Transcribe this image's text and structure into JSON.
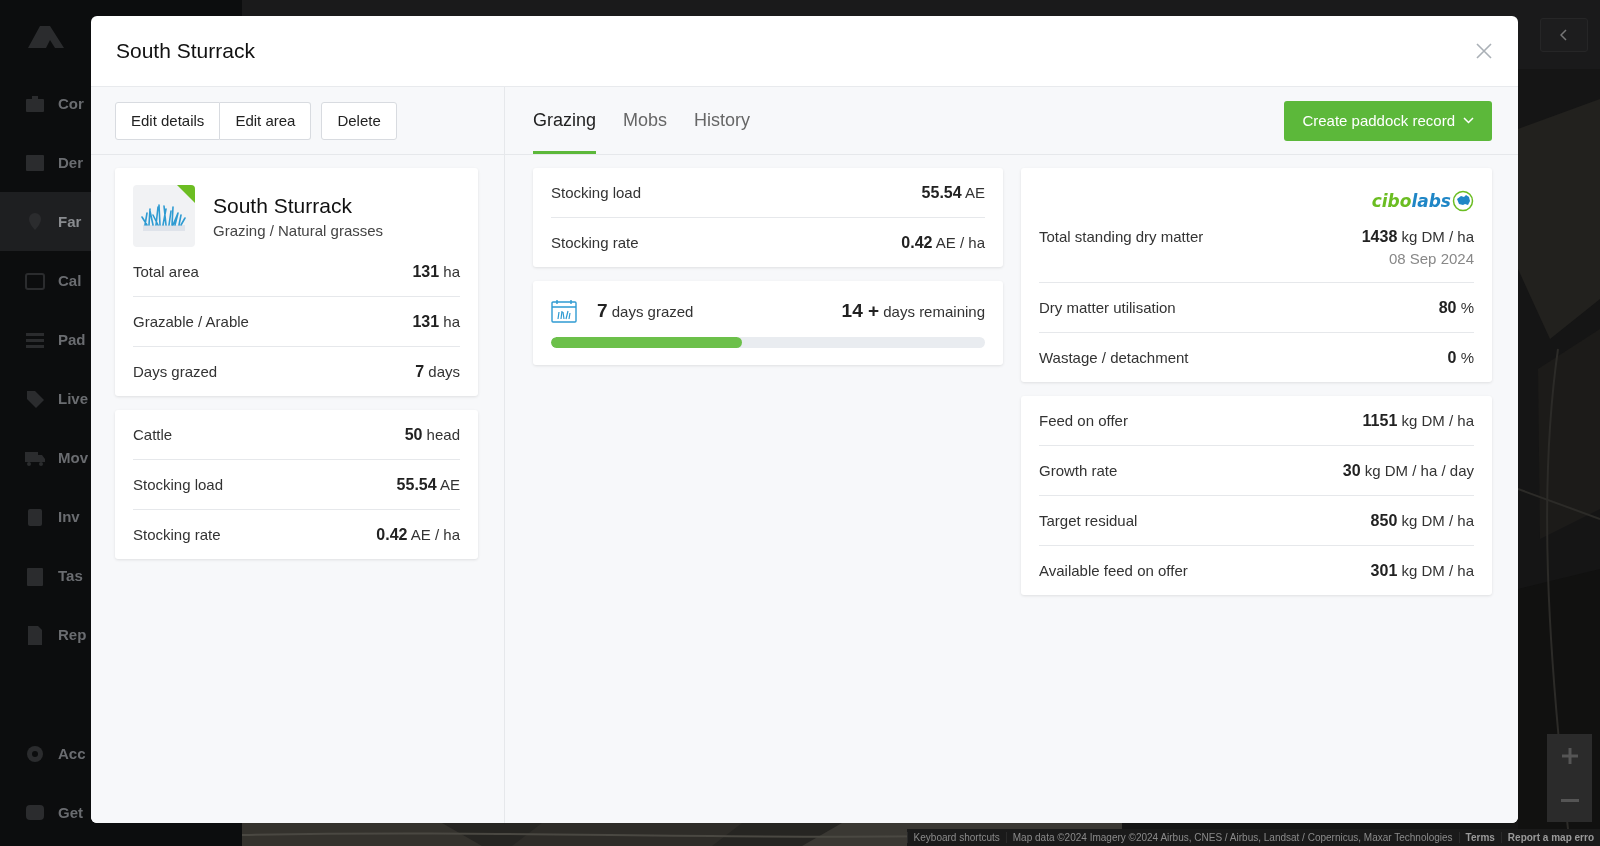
{
  "sidebar": {
    "items": [
      {
        "label": "Cor",
        "selected": false
      },
      {
        "label": "Der",
        "selected": false
      },
      {
        "label": "Far",
        "selected": true
      },
      {
        "label": "Cal",
        "selected": false
      },
      {
        "label": "Pad",
        "selected": false
      },
      {
        "label": "Live",
        "selected": false
      },
      {
        "label": "Mov",
        "selected": false
      },
      {
        "label": "Inv",
        "selected": false
      },
      {
        "label": "Tas",
        "selected": false
      },
      {
        "label": "Rep",
        "selected": false
      }
    ],
    "bottom_items": [
      {
        "label": "Acc",
        "selected": false
      },
      {
        "label": "Get",
        "selected": false
      }
    ]
  },
  "map": {
    "attribution": [
      "Keyboard shortcuts",
      "Map data ©2024 Imagery ©2024 Airbus, CNES / Airbus, Landsat / Copernicus, Maxar Technologies",
      "Terms",
      "Report a map erro"
    ]
  },
  "modal": {
    "title": "South Sturrack",
    "actions": [
      "Edit details",
      "Edit area",
      "Delete"
    ],
    "paddock": {
      "name": "South Sturrack",
      "subtitle": "Grazing / Natural grasses"
    },
    "summary": [
      {
        "label": "Total area",
        "value": "131",
        "unit": "ha"
      },
      {
        "label": "Grazable / Arable",
        "value": "131",
        "unit": "ha"
      },
      {
        "label": "Days grazed",
        "value": "7",
        "unit": "days"
      }
    ],
    "livestock": [
      {
        "label": "Cattle",
        "value": "50",
        "unit": "head"
      },
      {
        "label": "Stocking load",
        "value": "55.54",
        "unit": "AE"
      },
      {
        "label": "Stocking rate",
        "value": "0.42",
        "unit": "AE / ha"
      }
    ],
    "tabs": [
      {
        "label": "Grazing",
        "selected": true
      },
      {
        "label": "Mobs",
        "selected": false
      },
      {
        "label": "History",
        "selected": false
      }
    ],
    "create_button": "Create paddock record",
    "stocking": [
      {
        "label": "Stocking load",
        "value": "55.54",
        "unit": "AE"
      },
      {
        "label": "Stocking rate",
        "value": "0.42",
        "unit": "AE / ha"
      }
    ],
    "progress": {
      "grazed_value": "7",
      "grazed_label": "days grazed",
      "remaining_value": "14 +",
      "remaining_label": "days remaining",
      "level": 0.44
    },
    "pasture": {
      "logo": [
        {
          "text": "cibo",
          "color": "#6bbd22"
        },
        {
          "text": "labs",
          "color": "#1f86c6"
        }
      ],
      "rows": [
        {
          "label": "Total standing dry matter",
          "value": "1438",
          "unit": "kg DM / ha",
          "date": "08 Sep 2024"
        },
        {
          "label": "Dry matter utilisation",
          "value": "80",
          "unit": "%"
        },
        {
          "label": "Wastage / detachment",
          "value": "0",
          "unit": "%"
        }
      ]
    },
    "feed": [
      {
        "label": "Feed on offer",
        "value": "1151",
        "unit": "kg DM / ha"
      },
      {
        "label": "Growth rate",
        "value": "30",
        "unit": "kg DM / ha / day"
      },
      {
        "label": "Target residual",
        "value": "850",
        "unit": "kg DM / ha"
      },
      {
        "label": "Available feed on offer",
        "value": "301",
        "unit": "kg DM / ha"
      }
    ]
  }
}
